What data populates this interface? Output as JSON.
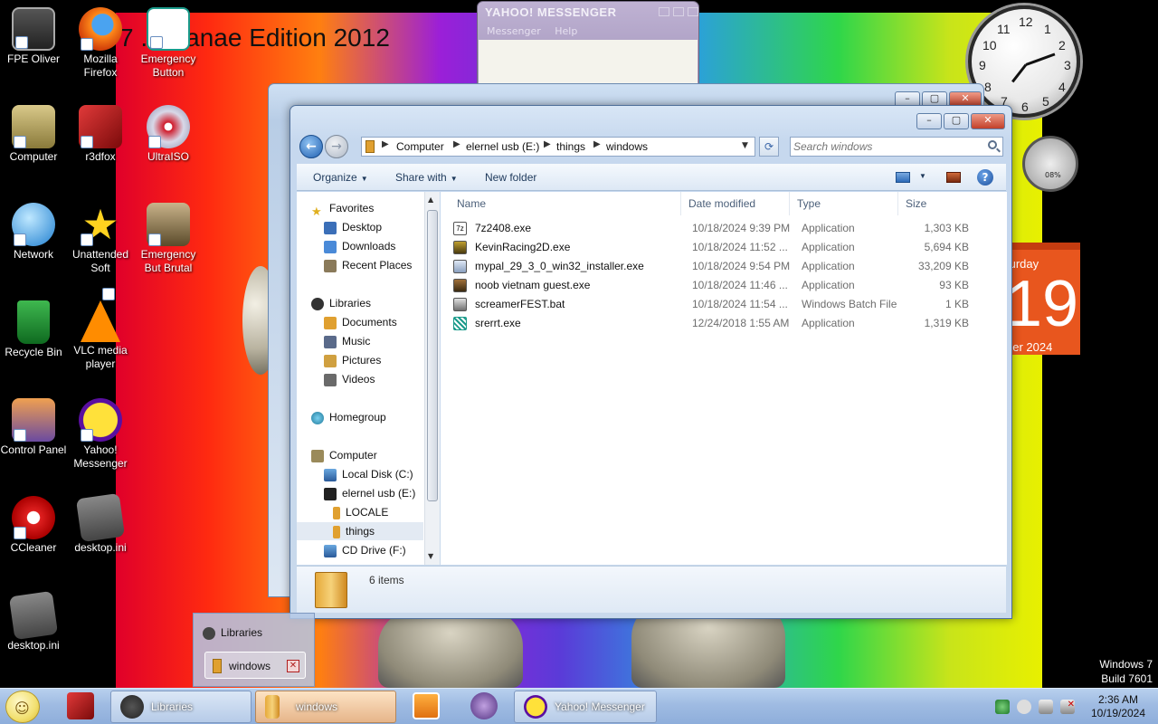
{
  "desktop": {
    "wallpaper_title": "7 ... Kanae Edition 2012",
    "icons": [
      {
        "label": "FPE Oliver"
      },
      {
        "label": "Mozilla Firefox"
      },
      {
        "label": "Emergency Button"
      },
      {
        "label": "Computer"
      },
      {
        "label": "r3dfox"
      },
      {
        "label": "UltraISO"
      },
      {
        "label": "Network"
      },
      {
        "label": "Unattended Soft"
      },
      {
        "label": "Emergency But Brutal"
      },
      {
        "label": "Recycle Bin"
      },
      {
        "label": "VLC media player"
      },
      {
        "label": "Control Panel"
      },
      {
        "label": "Yahoo! Messenger"
      },
      {
        "label": "CCleaner"
      },
      {
        "label": "desktop.ini"
      },
      {
        "label": "desktop.ini"
      }
    ],
    "windows_version": "Windows 7",
    "build": "Build 7601"
  },
  "gadgets": {
    "clock_numbers": [
      "12",
      "1",
      "2",
      "3",
      "4",
      "5",
      "6",
      "7",
      "8",
      "9",
      "10",
      "11"
    ],
    "calendar": {
      "day": "turday",
      "date": "19",
      "month": "ber 2024"
    },
    "meter_value": "08%"
  },
  "yahoo_window": {
    "title": "YAHOO! MESSENGER",
    "menu": [
      "Messenger",
      "Help"
    ]
  },
  "explorer": {
    "breadcrumb": [
      "Computer",
      "elernel usb (E:)",
      "things",
      "windows"
    ],
    "search_placeholder": "Search windows",
    "toolbar": {
      "organize": "Organize",
      "share_with": "Share with",
      "new_folder": "New folder"
    },
    "nav": {
      "favorites": "Favorites",
      "desktop": "Desktop",
      "downloads": "Downloads",
      "recent_places": "Recent Places",
      "libraries": "Libraries",
      "documents": "Documents",
      "music": "Music",
      "pictures": "Pictures",
      "videos": "Videos",
      "homegroup": "Homegroup",
      "computer": "Computer",
      "local_disk": "Local Disk (C:)",
      "usb": "elernel usb (E:)",
      "locale": "LOCALE",
      "things": "things",
      "cd_drive": "CD Drive (F:)"
    },
    "columns": {
      "name": "Name",
      "date_modified": "Date modified",
      "type": "Type",
      "size": "Size"
    },
    "files": [
      {
        "name": "7z2408.exe",
        "date": "10/18/2024 9:39 PM",
        "type": "Application",
        "size": "1,303 KB"
      },
      {
        "name": "KevinRacing2D.exe",
        "date": "10/18/2024 11:52 ...",
        "type": "Application",
        "size": "5,694 KB"
      },
      {
        "name": "mypal_29_3_0_win32_installer.exe",
        "date": "10/18/2024 9:54 PM",
        "type": "Application",
        "size": "33,209 KB"
      },
      {
        "name": "noob vietnam guest.exe",
        "date": "10/18/2024 11:46 ...",
        "type": "Application",
        "size": "93 KB"
      },
      {
        "name": "screamerFEST.bat",
        "date": "10/18/2024 11:54 ...",
        "type": "Windows Batch File",
        "size": "1 KB"
      },
      {
        "name": "srerrt.exe",
        "date": "12/24/2018 1:55 AM",
        "type": "Application",
        "size": "1,319 KB"
      }
    ],
    "item_count": "6 items"
  },
  "jump_list": {
    "libraries": "Libraries",
    "windows": "windows"
  },
  "taskbar": {
    "libraries": "Libraries",
    "windows": "windows",
    "yahoo": "Yahoo! Messenger",
    "time": "2:36 AM",
    "date": "10/19/2024"
  },
  "colors": {
    "accent": "#1f5fb0",
    "taskbar": "#9fbbe2",
    "selected_nav": "#e3eaf3"
  }
}
